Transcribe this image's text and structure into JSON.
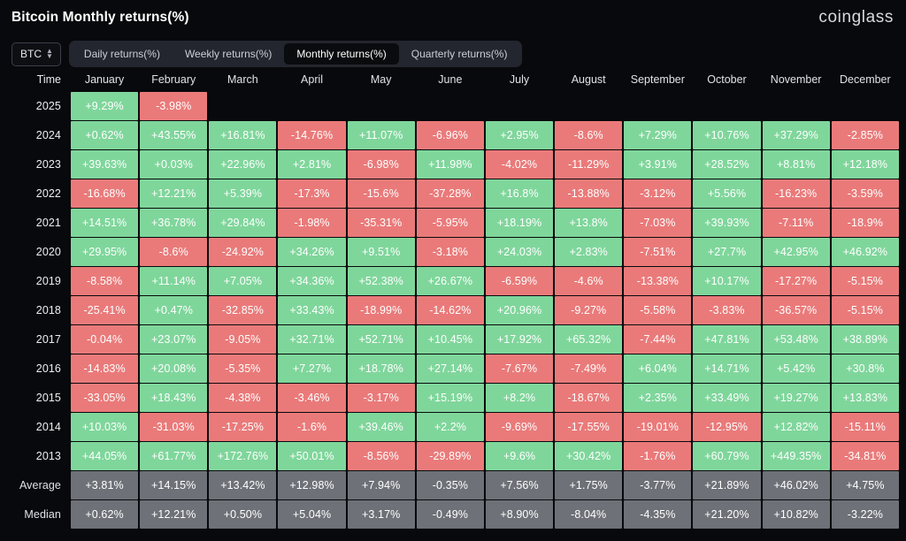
{
  "header": {
    "title": "Bitcoin Monthly returns(%)",
    "brand": "coinglass"
  },
  "controls": {
    "symbol": "BTC",
    "symbol_icon": "stepper-updown-icon",
    "tabs": [
      {
        "label": "Daily returns(%)",
        "active": false
      },
      {
        "label": "Weekly returns(%)",
        "active": false
      },
      {
        "label": "Monthly returns(%)",
        "active": true
      },
      {
        "label": "Quarterly returns(%)",
        "active": false
      }
    ]
  },
  "colors": {
    "positive": "#7fd69b",
    "negative": "#ea7a7a",
    "stat": "#6e7177",
    "background": "#08090c",
    "tab_active_bg": "#0a0b0e",
    "tab_bar_bg": "#23262e"
  },
  "chart_data": {
    "type": "heatmap",
    "title": "Bitcoin Monthly returns(%)",
    "xlabel": "",
    "ylabel": "Time",
    "columns": [
      "Time",
      "January",
      "February",
      "March",
      "April",
      "May",
      "June",
      "July",
      "August",
      "September",
      "October",
      "November",
      "December"
    ],
    "rows": [
      {
        "time": "2025",
        "values": [
          "+9.29%",
          "-3.98%",
          "",
          "",
          "",
          "",
          "",
          "",
          "",
          "",
          "",
          ""
        ]
      },
      {
        "time": "2024",
        "values": [
          "+0.62%",
          "+43.55%",
          "+16.81%",
          "-14.76%",
          "+11.07%",
          "-6.96%",
          "+2.95%",
          "-8.6%",
          "+7.29%",
          "+10.76%",
          "+37.29%",
          "-2.85%"
        ]
      },
      {
        "time": "2023",
        "values": [
          "+39.63%",
          "+0.03%",
          "+22.96%",
          "+2.81%",
          "-6.98%",
          "+11.98%",
          "-4.02%",
          "-11.29%",
          "+3.91%",
          "+28.52%",
          "+8.81%",
          "+12.18%"
        ]
      },
      {
        "time": "2022",
        "values": [
          "-16.68%",
          "+12.21%",
          "+5.39%",
          "-17.3%",
          "-15.6%",
          "-37.28%",
          "+16.8%",
          "-13.88%",
          "-3.12%",
          "+5.56%",
          "-16.23%",
          "-3.59%"
        ]
      },
      {
        "time": "2021",
        "values": [
          "+14.51%",
          "+36.78%",
          "+29.84%",
          "-1.98%",
          "-35.31%",
          "-5.95%",
          "+18.19%",
          "+13.8%",
          "-7.03%",
          "+39.93%",
          "-7.11%",
          "-18.9%"
        ]
      },
      {
        "time": "2020",
        "values": [
          "+29.95%",
          "-8.6%",
          "-24.92%",
          "+34.26%",
          "+9.51%",
          "-3.18%",
          "+24.03%",
          "+2.83%",
          "-7.51%",
          "+27.7%",
          "+42.95%",
          "+46.92%"
        ]
      },
      {
        "time": "2019",
        "values": [
          "-8.58%",
          "+11.14%",
          "+7.05%",
          "+34.36%",
          "+52.38%",
          "+26.67%",
          "-6.59%",
          "-4.6%",
          "-13.38%",
          "+10.17%",
          "-17.27%",
          "-5.15%"
        ]
      },
      {
        "time": "2018",
        "values": [
          "-25.41%",
          "+0.47%",
          "-32.85%",
          "+33.43%",
          "-18.99%",
          "-14.62%",
          "+20.96%",
          "-9.27%",
          "-5.58%",
          "-3.83%",
          "-36.57%",
          "-5.15%"
        ]
      },
      {
        "time": "2017",
        "values": [
          "-0.04%",
          "+23.07%",
          "-9.05%",
          "+32.71%",
          "+52.71%",
          "+10.45%",
          "+17.92%",
          "+65.32%",
          "-7.44%",
          "+47.81%",
          "+53.48%",
          "+38.89%"
        ]
      },
      {
        "time": "2016",
        "values": [
          "-14.83%",
          "+20.08%",
          "-5.35%",
          "+7.27%",
          "+18.78%",
          "+27.14%",
          "-7.67%",
          "-7.49%",
          "+6.04%",
          "+14.71%",
          "+5.42%",
          "+30.8%"
        ]
      },
      {
        "time": "2015",
        "values": [
          "-33.05%",
          "+18.43%",
          "-4.38%",
          "-3.46%",
          "-3.17%",
          "+15.19%",
          "+8.2%",
          "-18.67%",
          "+2.35%",
          "+33.49%",
          "+19.27%",
          "+13.83%"
        ]
      },
      {
        "time": "2014",
        "values": [
          "+10.03%",
          "-31.03%",
          "-17.25%",
          "-1.6%",
          "+39.46%",
          "+2.2%",
          "-9.69%",
          "-17.55%",
          "-19.01%",
          "-12.95%",
          "+12.82%",
          "-15.11%"
        ]
      },
      {
        "time": "2013",
        "values": [
          "+44.05%",
          "+61.77%",
          "+172.76%",
          "+50.01%",
          "-8.56%",
          "-29.89%",
          "+9.6%",
          "+30.42%",
          "-1.76%",
          "+60.79%",
          "+449.35%",
          "-34.81%"
        ]
      }
    ],
    "summary_rows": [
      {
        "time": "Average",
        "values": [
          "+3.81%",
          "+14.15%",
          "+13.42%",
          "+12.98%",
          "+7.94%",
          "-0.35%",
          "+7.56%",
          "+1.75%",
          "-3.77%",
          "+21.89%",
          "+46.02%",
          "+4.75%"
        ]
      },
      {
        "time": "Median",
        "values": [
          "+0.62%",
          "+12.21%",
          "+0.50%",
          "+5.04%",
          "+3.17%",
          "-0.49%",
          "+8.90%",
          "-8.04%",
          "-4.35%",
          "+21.20%",
          "+10.82%",
          "-3.22%"
        ]
      }
    ]
  }
}
